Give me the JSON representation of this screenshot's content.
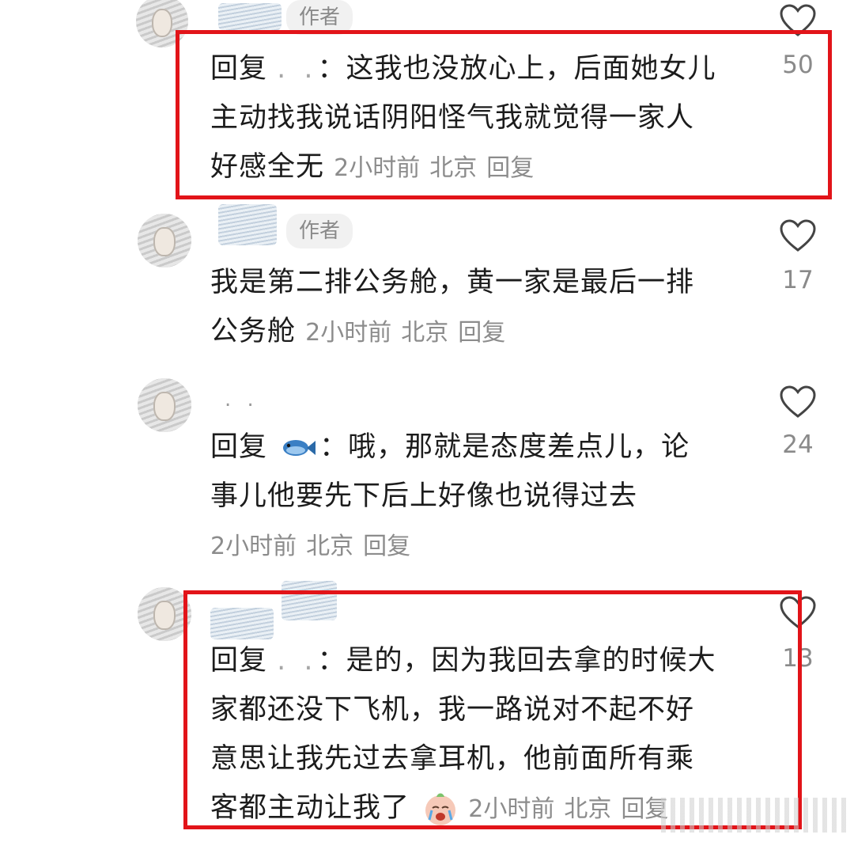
{
  "comments": [
    {
      "author_badge": "作者",
      "reply_prefix": "回复",
      "mention": ". .",
      "lines": [
        "：这我也没放心上，后面她女儿",
        "主动找我说话阴阳怪气我就觉得一家人",
        "好感全无"
      ],
      "time": "2小时前",
      "location": "北京",
      "reply_label": "回复",
      "likes": "50"
    },
    {
      "author_badge": "作者",
      "lines": [
        "我是第二排公务舱，黄一家是最后一排",
        "公务舱"
      ],
      "time": "2小时前",
      "location": "北京",
      "reply_label": "回复",
      "likes": "17"
    },
    {
      "name_dots": ". .",
      "reply_prefix": "回复",
      "lines": [
        "：哦，那就是态度差点儿，论",
        "事儿他要先下后上好像也说得过去"
      ],
      "time": "2小时前",
      "location": "北京",
      "reply_label": "回复",
      "likes": "24",
      "mention_icon": "fish-icon"
    },
    {
      "reply_prefix": "回复",
      "mention": ". .",
      "lines": [
        "：是的，因为我回去拿的时候大",
        "家都还没下飞机，我一路说对不起不好",
        "意思让我先过去拿耳机，他前面所有乘",
        "客都主动让我了"
      ],
      "time": "2小时前",
      "location": "北京",
      "reply_label": "回复",
      "likes": "13",
      "emoji": "crying-face-icon"
    }
  ],
  "colors": {
    "highlight": "#e21419",
    "meta": "#8c8c8c",
    "text": "#1c1c1c"
  }
}
